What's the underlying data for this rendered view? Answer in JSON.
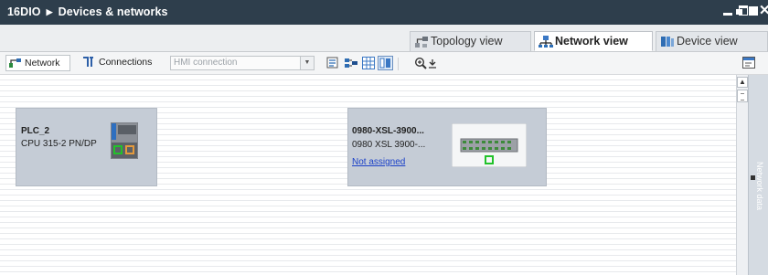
{
  "titlebar": {
    "project": "16DIO",
    "section": "Devices & networks"
  },
  "window_controls": [
    "minimize-icon",
    "restore-icon",
    "maximize-icon",
    "close-icon"
  ],
  "close_glyph": "✕",
  "tabs": [
    {
      "label": "Topology view",
      "icon": "topology-icon",
      "active": false
    },
    {
      "label": "Network view",
      "icon": "network-icon",
      "active": true
    },
    {
      "label": "Device view",
      "icon": "device-icon",
      "active": false
    }
  ],
  "toolbar": {
    "network_label": "Network",
    "connections_label": "Connections",
    "connection_type": "HMI connection"
  },
  "devices": [
    {
      "name": "PLC_2",
      "type": "CPU 315-2 PN/DP"
    },
    {
      "name": "0980-XSL-3900...",
      "type": "0980 XSL 3900-...",
      "link": "Not assigned"
    }
  ],
  "side_panel_label": "Network data",
  "colors": {
    "titlebar_bg": "#2e3e4c",
    "device_bg": "#c5ccd6",
    "port_green": "#22c22a",
    "port_orange": "#e59a3c",
    "link_blue": "#1a40c8"
  }
}
